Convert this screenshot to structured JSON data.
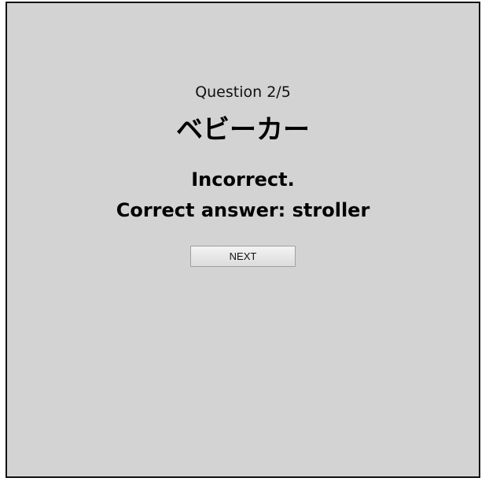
{
  "quiz": {
    "counter": "Question 2/5",
    "word": "ベビーカー",
    "result": "Incorrect.",
    "correct_answer": "Correct answer: stroller",
    "next_label": "NEXT"
  }
}
